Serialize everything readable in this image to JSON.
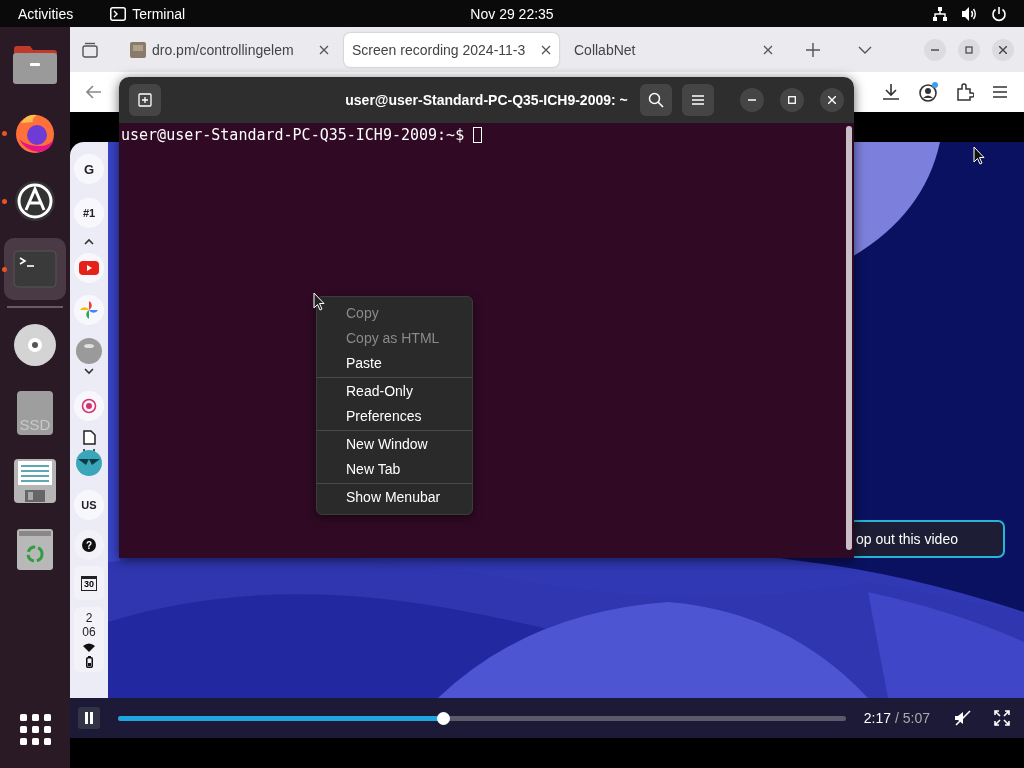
{
  "top_bar": {
    "activities": "Activities",
    "app_name": "Terminal",
    "clock": "Nov 29  22:35"
  },
  "dock": {
    "apps": [
      {
        "kind": "files",
        "running": false,
        "selected": false
      },
      {
        "kind": "firefox",
        "running": true,
        "selected": false
      },
      {
        "kind": "app-center",
        "running": true,
        "selected": false
      },
      {
        "kind": "terminal",
        "running": true,
        "selected": true
      }
    ],
    "devices": [
      {
        "kind": "disc"
      },
      {
        "kind": "drive",
        "label": "SSD"
      },
      {
        "kind": "editor"
      },
      {
        "kind": "trash"
      }
    ]
  },
  "browser": {
    "tabs": [
      {
        "title": "dro.pm/controllingelem",
        "selected": false,
        "favicon": true
      },
      {
        "title": "Screen recording 2024-11-3",
        "selected": true,
        "favicon": false
      },
      {
        "title": "CollabNet",
        "selected": false,
        "favicon": false
      }
    ],
    "sidebar": [
      {
        "kind": "letter",
        "label": "G"
      },
      {
        "kind": "letter",
        "label": "#1"
      },
      {
        "kind": "chevron-up"
      },
      {
        "kind": "youtube"
      },
      {
        "kind": "photos"
      },
      {
        "kind": "avatar"
      },
      {
        "kind": "chevron-down"
      },
      {
        "kind": "record"
      },
      {
        "kind": "document"
      },
      {
        "kind": "letter",
        "label": "US"
      },
      {
        "kind": "help",
        "label": "?"
      },
      {
        "kind": "calendar",
        "label": "30"
      },
      {
        "kind": "status",
        "hour": "2",
        "minute": "06"
      }
    ],
    "video": {
      "playing": true,
      "level": 0.447,
      "time": "2:17",
      "duration": "/ 5:07",
      "pop_out": "op out this video"
    }
  },
  "terminal": {
    "title": "user@user-Standard-PC-Q35-ICH9-2009: ~",
    "prompt": "user@user-Standard-PC-Q35-ICH9-2009:~$"
  },
  "context_menu": {
    "groups": [
      {
        "items": [
          {
            "label": "Copy",
            "disabled": true
          },
          {
            "label": "Copy as HTML",
            "disabled": true
          },
          {
            "label": "Paste",
            "disabled": false
          }
        ]
      },
      {
        "items": [
          {
            "label": "Read-Only",
            "disabled": false
          },
          {
            "label": "Preferences",
            "disabled": false
          }
        ]
      },
      {
        "items": [
          {
            "label": "New Window",
            "disabled": false
          },
          {
            "label": "New Tab",
            "disabled": false
          }
        ]
      },
      {
        "items": [
          {
            "label": "Show Menubar",
            "disabled": false
          }
        ]
      }
    ]
  }
}
